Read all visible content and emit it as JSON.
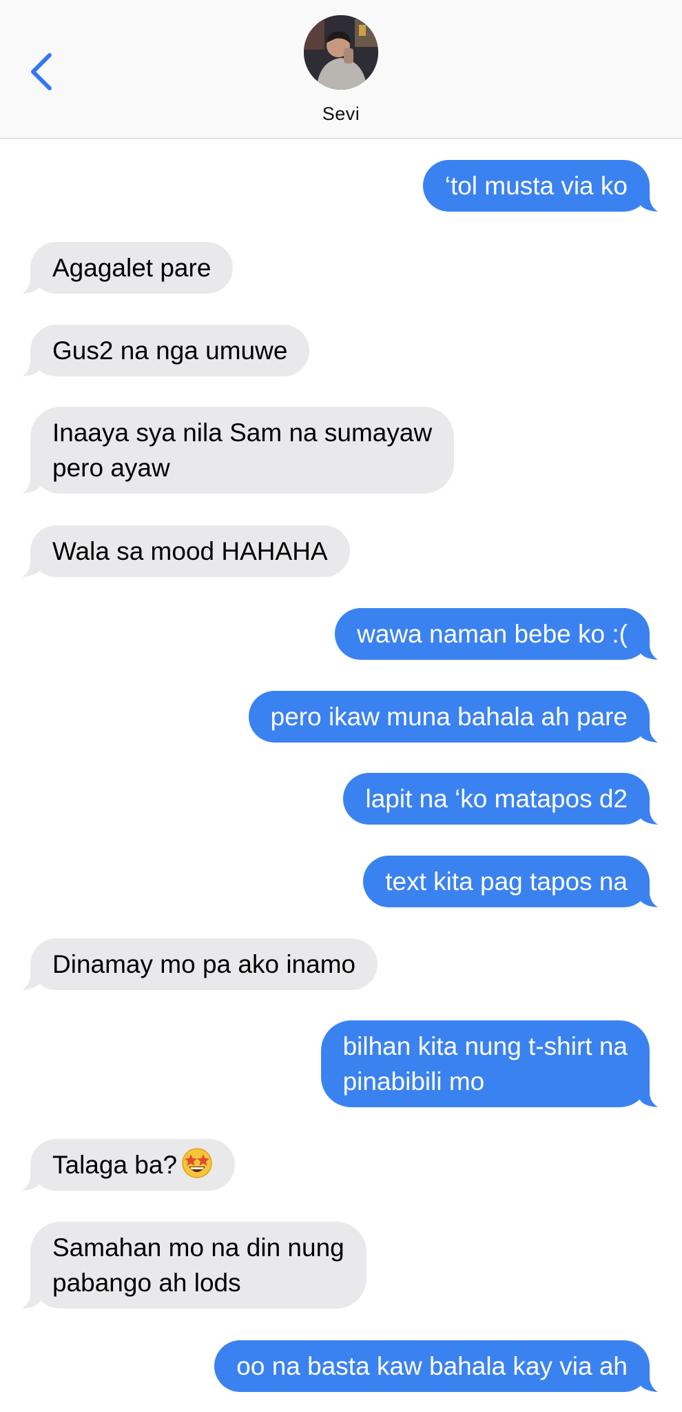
{
  "header": {
    "back_icon": "chevron-left-icon",
    "contact_name": "Sevi",
    "avatar": "contact-avatar-photo"
  },
  "colors": {
    "outgoing": "#3b82f1",
    "incoming": "#e9e9eb",
    "accent": "#3478f6"
  },
  "messages": [
    {
      "dir": "out",
      "text": "‘tol musta via ko"
    },
    {
      "dir": "in",
      "text": "Agagalet pare"
    },
    {
      "dir": "in",
      "text": "Gus2 na nga umuwe"
    },
    {
      "dir": "in",
      "text": "Inaaya sya nila Sam na sumayaw\npero ayaw"
    },
    {
      "dir": "in",
      "text": "Wala sa mood HAHAHA"
    },
    {
      "dir": "out",
      "text": "wawa naman bebe ko :("
    },
    {
      "dir": "out",
      "text": "pero ikaw muna bahala ah pare"
    },
    {
      "dir": "out",
      "text": "lapit na ‘ko matapos d2"
    },
    {
      "dir": "out",
      "text": "text kita pag tapos na"
    },
    {
      "dir": "in",
      "text": "Dinamay mo pa ako inamo"
    },
    {
      "dir": "out",
      "text": "bilhan kita nung t-shirt na\npinabibili mo"
    },
    {
      "dir": "in",
      "text": "Talaga ba?",
      "emoji": "star-struck-emoji"
    },
    {
      "dir": "in",
      "text": "Samahan mo na din nung\npabango ah lods"
    },
    {
      "dir": "out",
      "text": "oo na basta kaw bahala kay via ah"
    }
  ]
}
